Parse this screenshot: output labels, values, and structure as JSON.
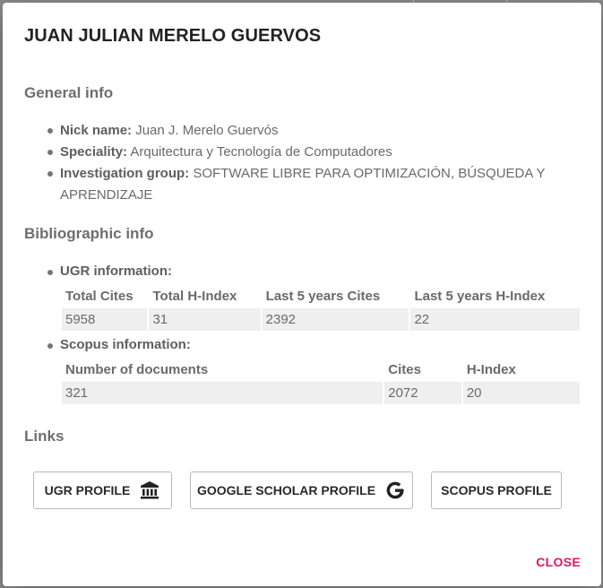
{
  "dialog": {
    "title": "JUAN JULIAN MERELO GUERVOS",
    "close_label": "CLOSE"
  },
  "general": {
    "heading": "General info",
    "nick_label": "Nick name:",
    "nick_value": "Juan J. Merelo Guervós",
    "speciality_label": "Speciality:",
    "speciality_value": "Arquitectura y Tecnología de Computadores",
    "group_label": "Investigation group:",
    "group_value": "SOFTWARE LIBRE PARA OPTIMIZACIÓN, BÚSQUEDA Y APRENDIZAJE"
  },
  "bibliographic": {
    "heading": "Bibliographic info",
    "ugr": {
      "label": "UGR information:",
      "headers": [
        "Total Cites",
        "Total H-Index",
        "Last 5 years Cites",
        "Last 5 years H-Index"
      ],
      "values": [
        "5958",
        "31",
        "2392",
        "22"
      ]
    },
    "scopus": {
      "label": "Scopus information:",
      "headers": [
        "Number of documents",
        "Cites",
        "H-Index"
      ],
      "values": [
        "321",
        "2072",
        "20"
      ]
    }
  },
  "links": {
    "heading": "Links",
    "ugr_profile": {
      "label": "UGR PROFILE",
      "icon": "institution-icon"
    },
    "google_scholar_profile": {
      "label": "GOOGLE SCHOLAR PROFILE",
      "icon": "google-icon"
    },
    "scopus_profile": {
      "label": "SCOPUS PROFILE"
    }
  },
  "colors": {
    "accent": "#e0195f",
    "table_cell_bg": "#efefef"
  }
}
